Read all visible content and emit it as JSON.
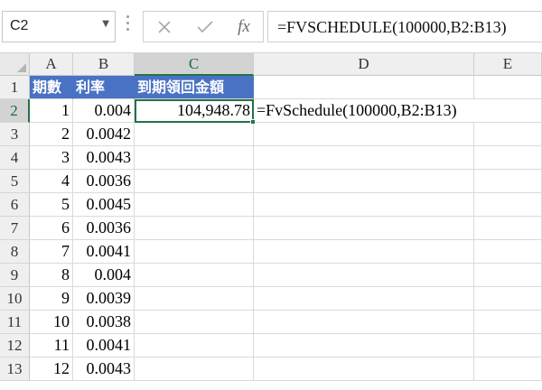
{
  "formula_bar": {
    "name_box": "C2",
    "name_box_caret_icon": "chevron-down-icon",
    "cancel_icon": "close-icon",
    "enter_icon": "check-icon",
    "function_label": "fx",
    "formula": "=FVSCHEDULE(100000,B2:B13)"
  },
  "sheet": {
    "columns": [
      "A",
      "B",
      "C",
      "D",
      "E"
    ],
    "rows": [
      "1",
      "2",
      "3",
      "4",
      "5",
      "6",
      "7",
      "8",
      "9",
      "10",
      "11",
      "12",
      "13"
    ],
    "header_row": {
      "A": "期數",
      "B": "利率",
      "C": "到期領回金額"
    },
    "data": [
      {
        "period": "1",
        "rate": "0.004"
      },
      {
        "period": "2",
        "rate": "0.0042"
      },
      {
        "period": "3",
        "rate": "0.0043"
      },
      {
        "period": "4",
        "rate": "0.0036"
      },
      {
        "period": "5",
        "rate": "0.0045"
      },
      {
        "period": "6",
        "rate": "0.0036"
      },
      {
        "period": "7",
        "rate": "0.0041"
      },
      {
        "period": "8",
        "rate": "0.004"
      },
      {
        "period": "9",
        "rate": "0.0039"
      },
      {
        "period": "10",
        "rate": "0.0038"
      },
      {
        "period": "11",
        "rate": "0.0041"
      },
      {
        "period": "12",
        "rate": "0.0043"
      }
    ],
    "result_value": "104,948.78",
    "formula_note": "=FvSchedule(100000,B2:B13)",
    "active_cell": "C2",
    "header_fill_color": "#4a72c4",
    "selection_color": "#217346"
  }
}
